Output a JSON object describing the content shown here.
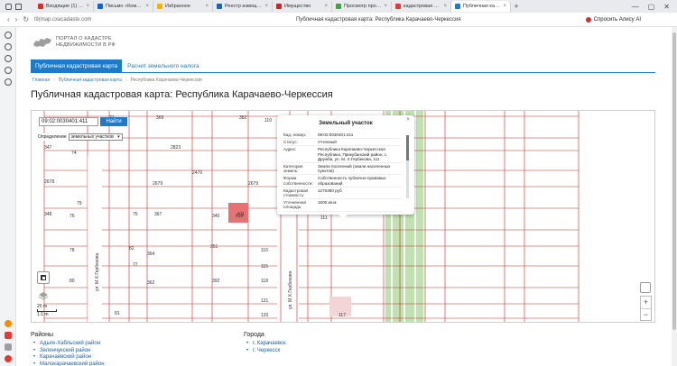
{
  "browser": {
    "tabs": [
      {
        "label": "Входящие (1) - image",
        "color": "#d93025",
        "active": false
      },
      {
        "label": "Письмо «Коммерческ",
        "color": "#0a66d8",
        "active": false
      },
      {
        "label": "Избранное",
        "color": "#f4b400",
        "active": false
      },
      {
        "label": "Реестр извещений",
        "color": "#1565c0",
        "active": false
      },
      {
        "label": "Имущество",
        "color": "#c62828",
        "active": false
      },
      {
        "label": "Просмотр процедуры",
        "color": "#43a047",
        "active": false
      },
      {
        "label": "кадастровая карта ка",
        "color": "#e53935",
        "active": false
      },
      {
        "label": "Публичная кадастр",
        "color": "#1e7bc8",
        "active": true
      }
    ],
    "new_tab": "+",
    "window_controls": [
      "—",
      "▢",
      "✕"
    ],
    "url": "l9(map.cxacadaste.com",
    "page_title": "Публичная кадастровая карта: Республика Карачаево-Черкессия",
    "alice_label": "Спросить Алису AI"
  },
  "site": {
    "logo_line1": "ПОРТАЛ О КАДАСТРЕ",
    "logo_line2": "НЕДВИЖИМОСТИ В РФ",
    "menu": [
      "Публичная кадастровая карта",
      "Расчет земельного налога"
    ],
    "breadcrumbs": [
      "Главная",
      "Публичная кадастровая карта",
      "Республика Карачаево-Черкессия"
    ],
    "heading": "Публичная кадастровая карта: Республика Карачаево-Черкессия"
  },
  "map": {
    "search_value": "09:02:0030401:411",
    "search_button": "Найти",
    "mode_label": "Определение",
    "mode_value": "земельных участков",
    "scale": "20 m",
    "scale_sub": "1:1 m",
    "zoom_in": "+",
    "zoom_out": "−",
    "street_label": "ул. М.Х.Гербекова",
    "parcel_numbers": [
      "71",
      "369",
      "382",
      "110",
      "347",
      "74",
      "2678",
      "2679",
      "2679",
      "2823",
      "2476",
      "79",
      "348",
      "76",
      "75",
      "367",
      "340",
      "410",
      "82",
      "351",
      "116",
      "115",
      "121",
      "77",
      "392",
      "118",
      "80",
      "81",
      "120",
      "117",
      "111",
      "78",
      "364",
      "362",
      "411"
    ]
  },
  "popup": {
    "title": "Земельный участок",
    "close": "×",
    "rows": [
      {
        "k": "Кад. номер:",
        "v": "09:02:0030401:411"
      },
      {
        "k": "Статус:",
        "v": "Учтенный"
      },
      {
        "k": "Адрес:",
        "v": "Республика Карачаево-Черкесская Республика, Прикубанский район, с. Дружба, ул. М. Х.Гербекова, 111"
      },
      {
        "k": "Категория земель:",
        "v": "Земли поселений (земли населенных пунктов)"
      },
      {
        "k": "Форма собственности:",
        "v": "Собственность публично-правовых образований"
      },
      {
        "k": "Кадастровая стоимость:",
        "v": "1270480 руб"
      },
      {
        "k": "Уточненная площадь:",
        "v": "1600 кв.м"
      }
    ]
  },
  "regions": {
    "title": "Районы",
    "items": [
      "Адыге-Хабльский район",
      "Зеленчукский район",
      "Карачаевский район",
      "Малокарачаевский район"
    ]
  },
  "cities": {
    "title": "Города",
    "items": [
      "г. Карачаевск",
      "г. Черкесск"
    ]
  }
}
